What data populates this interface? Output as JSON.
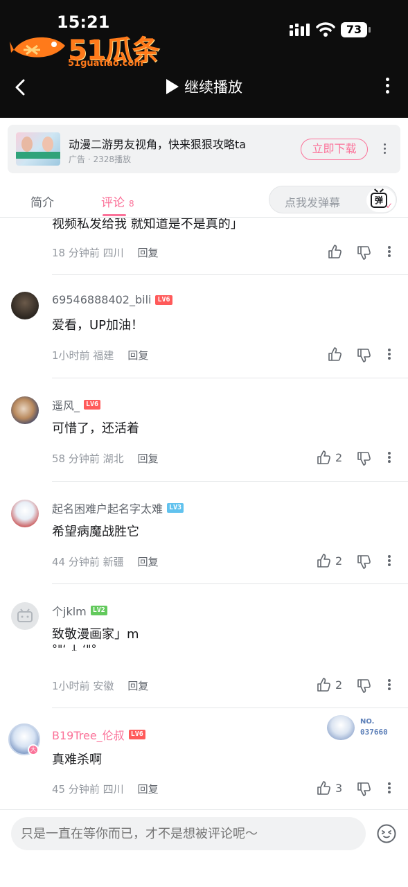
{
  "status_bar": {
    "time": "15:21",
    "battery": "73"
  },
  "logo": {
    "name": "51瓜条",
    "site": "51guatiao.com"
  },
  "nav": {
    "continue_label": "继续播放"
  },
  "ad": {
    "title": "动漫二游男友视角，快来狠狠攻略ta",
    "meta": "广告 · 2328播放",
    "button": "立即下载"
  },
  "tabs": {
    "intro": "简介",
    "comments": "评论",
    "comments_count": "8",
    "danmaku_placeholder": "点我发弹幕",
    "danmaku_icon_char": "弹"
  },
  "colors": {
    "accent": "#fb7299",
    "lv6": "#ff5a5a",
    "lv3": "#61c2ee",
    "lv2": "#62c95c"
  },
  "comments": [
    {
      "user": "",
      "level": "",
      "text": "视频私发给我 就知道是不是真的」",
      "time": "18 分钟前",
      "location": "四川",
      "reply": "回复",
      "likes": ""
    },
    {
      "user": "69546888402_bili",
      "level": "LV6",
      "text": "爱看，UP加油！",
      "time": "1小时前",
      "location": "福建",
      "reply": "回复",
      "likes": ""
    },
    {
      "user": "遥风_",
      "level": "LV6",
      "text": "可惜了，还活着",
      "time": "58 分钟前",
      "location": "湖北",
      "reply": "回复",
      "likes": "2"
    },
    {
      "user": "起名困难户起名字太难",
      "level": "LV3",
      "text": "希望病魔战胜它",
      "time": "44 分钟前",
      "location": "新疆",
      "reply": "回复",
      "likes": "2"
    },
    {
      "user": "个jklm",
      "level": "LV2",
      "text": "致敬漫画家」m",
      "text2": "°\"‘ ↓ ‘\"°",
      "time": "1小时前",
      "location": "安徽",
      "reply": "回复",
      "likes": "2"
    },
    {
      "user": "B19Tree_伦叔",
      "level": "LV6",
      "text": "真难杀啊",
      "time": "45 分钟前",
      "location": "四川",
      "reply": "回复",
      "likes": "3",
      "badge_label": "NO.",
      "badge_number": "037660"
    }
  ],
  "input": {
    "placeholder": "只是一直在等你而已，才不是想被评论呢～"
  }
}
